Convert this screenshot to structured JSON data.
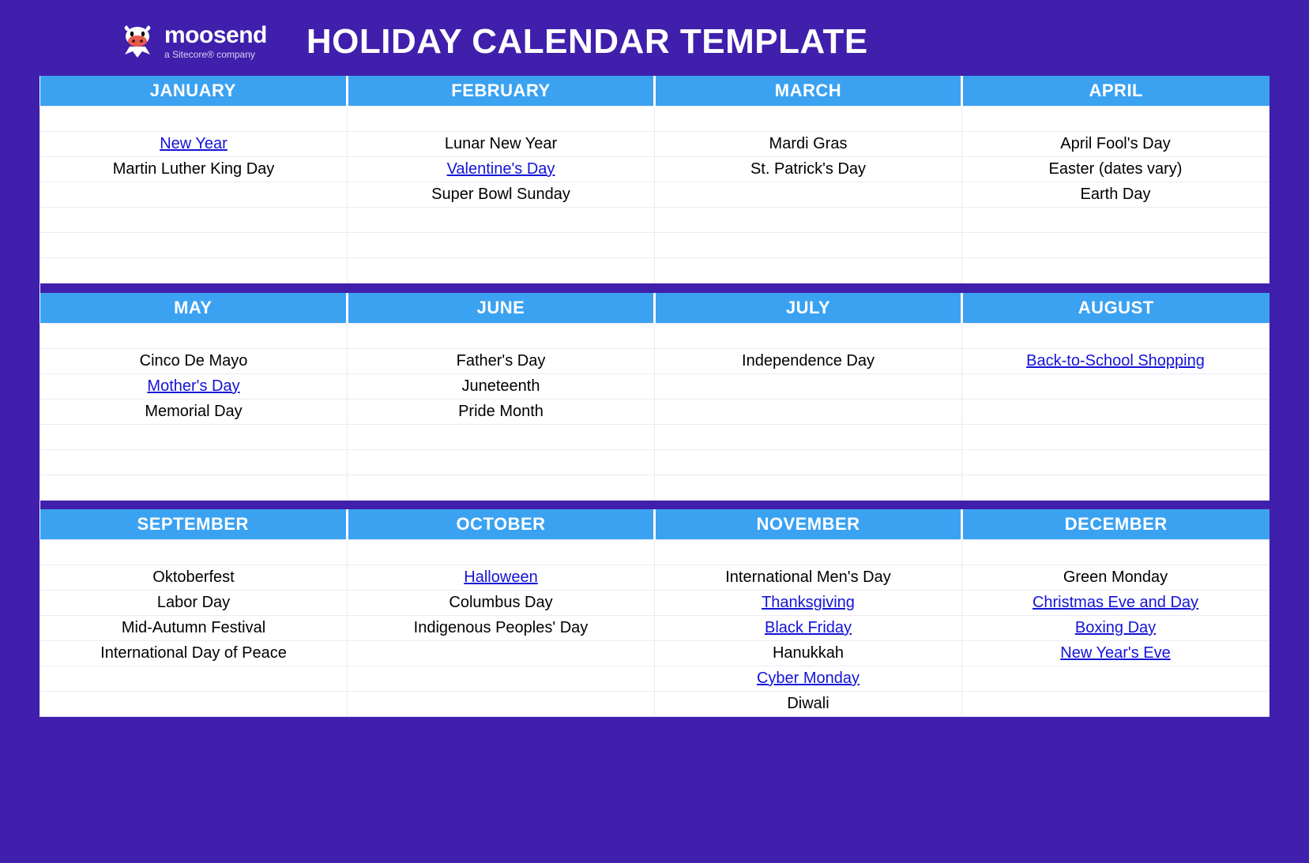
{
  "brand": {
    "name": "moosend",
    "tagline": "a Sitecore® company"
  },
  "title": "HOLIDAY CALENDAR TEMPLATE",
  "rows_per_section": 6,
  "sections": [
    {
      "months": [
        "JANUARY",
        "FEBRUARY",
        "MARCH",
        "APRIL"
      ],
      "cols": [
        [
          {
            "t": "New Year",
            "l": true
          },
          {
            "t": "Martin Luther King Day"
          }
        ],
        [
          {
            "t": "Lunar New Year"
          },
          {
            "t": "Valentine's Day",
            "l": true
          },
          {
            "t": "Super Bowl Sunday"
          }
        ],
        [
          {
            "t": "Mardi Gras"
          },
          {
            "t": "St. Patrick's Day"
          }
        ],
        [
          {
            "t": "April Fool's Day"
          },
          {
            "t": "Easter (dates vary)"
          },
          {
            "t": "Earth Day"
          }
        ]
      ]
    },
    {
      "months": [
        "MAY",
        "JUNE",
        "JULY",
        "AUGUST"
      ],
      "cols": [
        [
          {
            "t": "Cinco De Mayo"
          },
          {
            "t": "Mother's Day",
            "l": true
          },
          {
            "t": "Memorial Day"
          }
        ],
        [
          {
            "t": "Father's Day"
          },
          {
            "t": "Juneteenth"
          },
          {
            "t": "Pride Month"
          }
        ],
        [
          {
            "t": "Independence Day"
          }
        ],
        [
          {
            "t": "Back-to-School Shopping",
            "l": true
          }
        ]
      ]
    },
    {
      "months": [
        "SEPTEMBER",
        "OCTOBER",
        "NOVEMBER",
        "DECEMBER"
      ],
      "cols": [
        [
          {
            "t": "Oktoberfest"
          },
          {
            "t": "Labor Day"
          },
          {
            "t": "Mid-Autumn Festival"
          },
          {
            "t": "International Day of Peace"
          }
        ],
        [
          {
            "t": "Halloween",
            "l": true
          },
          {
            "t": "Columbus Day"
          },
          {
            "t": "Indigenous Peoples' Day"
          }
        ],
        [
          {
            "t": "International Men's Day"
          },
          {
            "t": "Thanksgiving",
            "l": true
          },
          {
            "t": "Black Friday",
            "l": true
          },
          {
            "t": "Hanukkah"
          },
          {
            "t": "Cyber Monday",
            "l": true
          },
          {
            "t": "Diwali"
          }
        ],
        [
          {
            "t": "Green Monday"
          },
          {
            "t": "Christmas Eve and Day",
            "l": true
          },
          {
            "t": "Boxing Day",
            "l": true
          },
          {
            "t": "New Year's Eve",
            "l": true
          }
        ]
      ]
    }
  ]
}
